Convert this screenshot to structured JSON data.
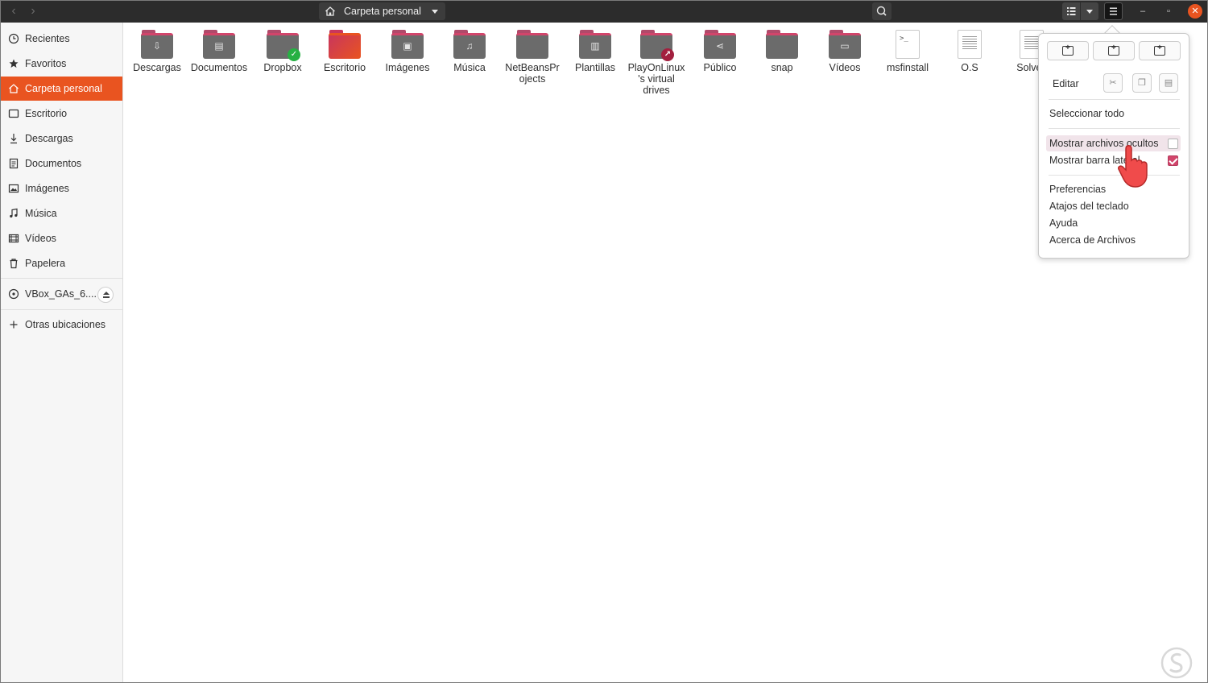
{
  "header": {
    "back": "‹",
    "forward": "›",
    "location": "Carpeta personal",
    "window_controls": {
      "minimize": "–",
      "maximize": "▫",
      "close": "✕"
    }
  },
  "sidebar": {
    "items": [
      {
        "label": "Recientes",
        "icon": "clock-icon"
      },
      {
        "label": "Favoritos",
        "icon": "star-icon"
      },
      {
        "label": "Carpeta personal",
        "icon": "home-icon",
        "active": true
      },
      {
        "label": "Escritorio",
        "icon": "desktop-icon"
      },
      {
        "label": "Descargas",
        "icon": "download-icon"
      },
      {
        "label": "Documentos",
        "icon": "document-icon"
      },
      {
        "label": "Imágenes",
        "icon": "image-icon"
      },
      {
        "label": "Música",
        "icon": "music-icon"
      },
      {
        "label": "Vídeos",
        "icon": "video-icon"
      },
      {
        "label": "Papelera",
        "icon": "trash-icon"
      }
    ],
    "device": {
      "label": "VBox_GAs_6....",
      "icon": "disc-icon"
    },
    "other": {
      "label": "Otras ubicaciones",
      "icon": "plus-icon"
    }
  },
  "files": [
    {
      "name": "Descargas",
      "type": "folder",
      "glyph": "⇩"
    },
    {
      "name": "Documentos",
      "type": "folder",
      "glyph": "▤"
    },
    {
      "name": "Dropbox",
      "type": "folder",
      "glyph": "",
      "badge": "✓"
    },
    {
      "name": "Escritorio",
      "type": "folder-desktop",
      "glyph": ""
    },
    {
      "name": "Imágenes",
      "type": "folder",
      "glyph": "▣"
    },
    {
      "name": "Música",
      "type": "folder",
      "glyph": "♫"
    },
    {
      "name": "NetBeansProjects",
      "type": "folder",
      "glyph": ""
    },
    {
      "name": "Plantillas",
      "type": "folder",
      "glyph": "▥"
    },
    {
      "name": "PlayOnLinux's virtual drives",
      "type": "folder",
      "glyph": "",
      "badge": "↗"
    },
    {
      "name": "Público",
      "type": "folder",
      "glyph": "⋖"
    },
    {
      "name": "snap",
      "type": "folder",
      "glyph": ""
    },
    {
      "name": "Vídeos",
      "type": "folder",
      "glyph": "▭"
    },
    {
      "name": "msfinstall",
      "type": "script",
      "glyph": ">_"
    },
    {
      "name": "O.S",
      "type": "document",
      "glyph": ""
    },
    {
      "name": "Solveti",
      "type": "document",
      "glyph": ""
    }
  ],
  "menu": {
    "edit_label": "Editar",
    "select_all": "Seleccionar todo",
    "show_hidden": "Mostrar archivos ocultos",
    "show_hidden_checked": false,
    "show_sidebar": "Mostrar barra lateral",
    "show_sidebar_checked": true,
    "preferences": "Preferencias",
    "shortcuts": "Atajos del teclado",
    "help": "Ayuda",
    "about": "Acerca de Archivos"
  },
  "colors": {
    "accent": "#e95420",
    "folder_top": "#d2456b",
    "check_on": "#d2456b",
    "cursor": "#f04b4b"
  }
}
